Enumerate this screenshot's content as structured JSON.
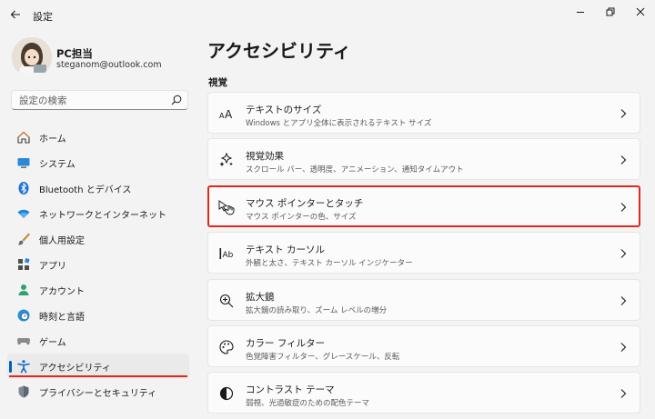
{
  "app": {
    "title": "設定"
  },
  "user": {
    "name": "PC担当",
    "email": "steganom@outlook.com"
  },
  "search": {
    "placeholder": "設定の検索"
  },
  "nav": {
    "items": [
      {
        "label": "ホーム",
        "icon": "home-icon"
      },
      {
        "label": "システム",
        "icon": "system-icon"
      },
      {
        "label": "Bluetooth とデバイス",
        "icon": "bluetooth-icon"
      },
      {
        "label": "ネットワークとインターネット",
        "icon": "network-icon"
      },
      {
        "label": "個人用設定",
        "icon": "personalization-icon"
      },
      {
        "label": "アプリ",
        "icon": "apps-icon"
      },
      {
        "label": "アカウント",
        "icon": "account-icon"
      },
      {
        "label": "時刻と言語",
        "icon": "time-language-icon"
      },
      {
        "label": "ゲーム",
        "icon": "gaming-icon"
      },
      {
        "label": "アクセシビリティ",
        "icon": "accessibility-icon",
        "active": true
      },
      {
        "label": "プライバシーとセキュリティ",
        "icon": "shield-icon"
      }
    ]
  },
  "main": {
    "title": "アクセシビリティ",
    "section": "視覚",
    "cards": [
      {
        "title": "テキストのサイズ",
        "subtitle": "Windows とアプリ全体に表示されるテキスト サイズ",
        "icon": "text-size-icon"
      },
      {
        "title": "視覚効果",
        "subtitle": "スクロール バー、透明度、アニメーション、通知タイムアウト",
        "icon": "visual-effects-icon"
      },
      {
        "title": "マウス ポインターとタッチ",
        "subtitle": "マウス ポインターの色、サイズ",
        "icon": "mouse-pointer-icon",
        "highlighted": true
      },
      {
        "title": "テキスト カーソル",
        "subtitle": "外観と太さ、テキスト カーソル インジケーター",
        "icon": "text-cursor-icon"
      },
      {
        "title": "拡大鏡",
        "subtitle": "拡大鏡の読み取り、ズーム レベルの増分",
        "icon": "magnifier-icon"
      },
      {
        "title": "カラー フィルター",
        "subtitle": "色覚障害フィルター、グレースケール、反転",
        "icon": "color-filter-icon"
      },
      {
        "title": "コントラスト テーマ",
        "subtitle": "弱視、光過敏症のための配色テーマ",
        "icon": "contrast-icon"
      }
    ]
  },
  "colors": {
    "accent": "#005fb8",
    "highlight_red": "#e0291c",
    "background": "#f3f3f3",
    "card": "#fbfbfb"
  }
}
